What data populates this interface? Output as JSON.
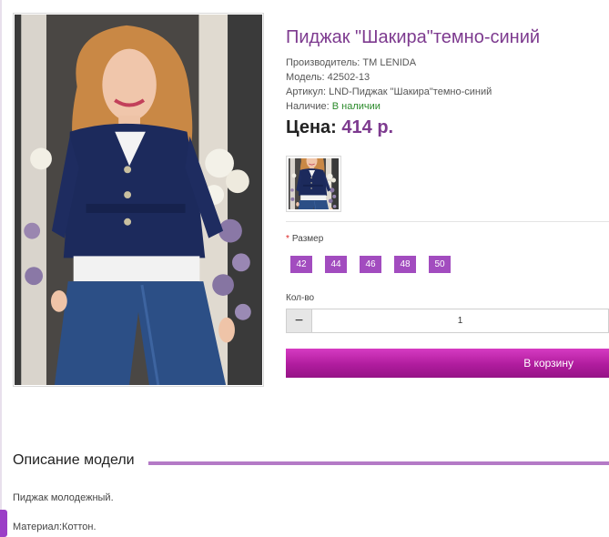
{
  "product": {
    "title": "Пиджак \"Шакира\"темно-синий",
    "manufacturer": "Производитель: ТМ LENIDA",
    "model": "Модель: 42502-13",
    "sku": "Артикул: LND-Пиджак \"Шакира\"темно-синий",
    "availability_label": "Наличие: ",
    "availability_value": "В наличии",
    "price_label": "Цена: ",
    "price_value": "414 р."
  },
  "options": {
    "size_required_mark": "*",
    "size_label": "Размер",
    "sizes": [
      "42",
      "44",
      "46",
      "48",
      "50"
    ]
  },
  "quantity": {
    "label": "Кол-во",
    "minus": "−",
    "value": "1"
  },
  "cart_button": "В корзину",
  "description": {
    "title": "Описание модели",
    "paragraph1": "Пиджак молодежный.",
    "paragraph2": "Материал:Коттон."
  },
  "colors": {
    "accent": "#7d3a8f",
    "size_button": "#a24cbf",
    "cart_button": "#b01c9e",
    "in_stock": "#2a8a2a",
    "description_rule": "#b47ac6"
  }
}
